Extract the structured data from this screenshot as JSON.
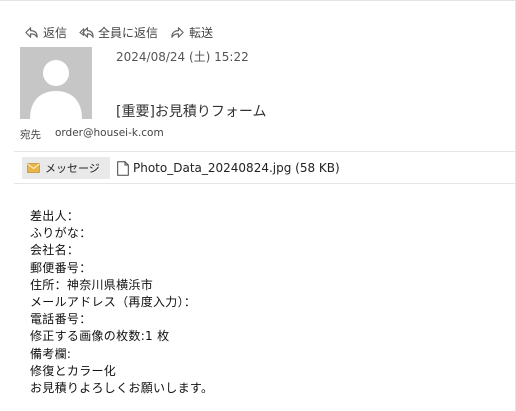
{
  "toolbar": {
    "reply": "返信",
    "reply_all": "全員に返信",
    "forward": "転送"
  },
  "header": {
    "date": "2024/08/24 (土) 15:22",
    "subject": "[重要]お見積りフォーム",
    "to_label": "宛先",
    "to_address": "order@housei-k.com"
  },
  "attachments": {
    "message_tab": "メッセージ",
    "file": "Photo_Data_20240824.jpg (58 KB)"
  },
  "body_lines": [
    "差出人：",
    "ふりがな：",
    "会社名：",
    "郵便番号：",
    "住所：神奈川県横浜市",
    "メールアドレス（再度入力）：",
    "電話番号：",
    "修正する画像の枚数:1 枚",
    "備考欄:",
    "修復とカラー化",
    "お見積りよろしくお願いします。"
  ],
  "colors": {
    "avatar_bg": "#c6c6c6",
    "tab_bg": "#e9e9e9",
    "mail_icon": "#e8b54a"
  }
}
